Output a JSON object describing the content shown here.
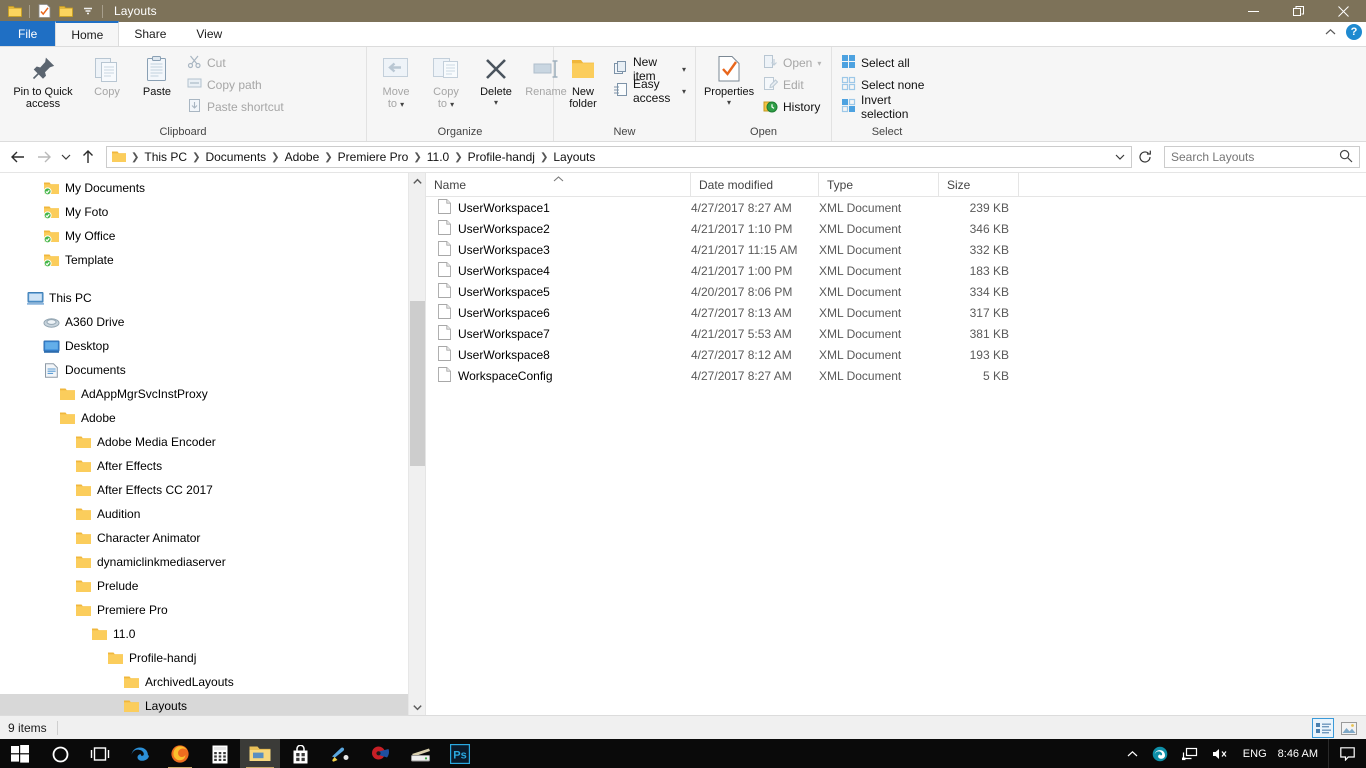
{
  "window": {
    "title": "Layouts",
    "quick_access": [
      "folder-icon",
      "properties-check-icon",
      "new-folder-icon",
      "customize-qat-caret"
    ],
    "controls": {
      "minimize": "minimize-icon",
      "restore": "restore-icon",
      "close": "close-icon"
    }
  },
  "tabs": [
    {
      "label": "File",
      "kind": "file"
    },
    {
      "label": "Home",
      "kind": "active"
    },
    {
      "label": "Share",
      "kind": "normal"
    },
    {
      "label": "View",
      "kind": "normal"
    }
  ],
  "tab_right": {
    "collapse": "chevron-up-icon",
    "help": "?"
  },
  "ribbon": {
    "groups": [
      {
        "label": "Clipboard",
        "big": [
          {
            "label": "Pin to Quick\naccess",
            "line1": "Pin to Quick",
            "line2": "access",
            "icon": "pin-icon",
            "disabled": false
          },
          {
            "label": "Copy",
            "line1": "Copy",
            "line2": "",
            "icon": "copy-icon",
            "disabled": true
          },
          {
            "label": "Paste",
            "line1": "Paste",
            "line2": "",
            "icon": "paste-icon",
            "disabled": false
          }
        ],
        "small": [
          {
            "label": "Cut",
            "icon": "scissors-icon",
            "disabled": true
          },
          {
            "label": "Copy path",
            "icon": "copy-path-icon",
            "disabled": true
          },
          {
            "label": "Paste shortcut",
            "icon": "paste-shortcut-icon",
            "disabled": true
          }
        ]
      },
      {
        "label": "Organize",
        "big": [
          {
            "label": "Move to",
            "line1": "Move",
            "line2": "to",
            "icon": "move-to-icon",
            "disabled": true,
            "caret": true
          },
          {
            "label": "Copy to",
            "line1": "Copy",
            "line2": "to",
            "icon": "copy-to-icon",
            "disabled": true,
            "caret": true
          },
          {
            "label": "Delete",
            "line1": "Delete",
            "line2": "",
            "icon": "delete-x-icon",
            "disabled": false,
            "caret": true
          },
          {
            "label": "Rename",
            "line1": "Rename",
            "line2": "",
            "icon": "rename-icon",
            "disabled": true
          }
        ],
        "small": []
      },
      {
        "label": "New",
        "big": [
          {
            "label": "New folder",
            "line1": "New",
            "line2": "folder",
            "icon": "new-folder-icon",
            "disabled": false
          }
        ],
        "small": [
          {
            "label": "New item",
            "icon": "new-item-icon",
            "disabled": false,
            "caret": true
          },
          {
            "label": "Easy access",
            "icon": "easy-access-icon",
            "disabled": false,
            "caret": true
          }
        ]
      },
      {
        "label": "Open",
        "big": [
          {
            "label": "Properties",
            "line1": "Properties",
            "line2": "",
            "icon": "properties-icon",
            "disabled": false,
            "caret": true
          }
        ],
        "small": [
          {
            "label": "Open",
            "icon": "open-icon",
            "disabled": true,
            "caret": true
          },
          {
            "label": "Edit",
            "icon": "edit-icon",
            "disabled": true
          },
          {
            "label": "History",
            "icon": "history-icon",
            "disabled": false
          }
        ]
      },
      {
        "label": "Select",
        "big": [],
        "small": [
          {
            "label": "Select all",
            "icon": "select-all-icon",
            "disabled": false
          },
          {
            "label": "Select none",
            "icon": "select-none-icon",
            "disabled": false
          },
          {
            "label": "Invert selection",
            "icon": "invert-selection-icon",
            "disabled": false
          }
        ]
      }
    ]
  },
  "address": {
    "back": "back-arrow-icon",
    "forward": "forward-arrow-icon",
    "recent": "recent-locations-caret",
    "up": "up-arrow-icon",
    "crumbs": [
      "This PC",
      "Documents",
      "Adobe",
      "Premiere Pro",
      "11.0",
      "Profile-handj",
      "Layouts"
    ],
    "refresh": "refresh-icon",
    "dropdown": "address-dropdown-caret"
  },
  "search": {
    "placeholder": "Search Layouts",
    "value": "",
    "icon": "search-icon"
  },
  "sidebar": {
    "items": [
      {
        "label": "My Documents",
        "icon": "folder-synced-icon",
        "indent": 2,
        "selected": false
      },
      {
        "label": "My Foto",
        "icon": "folder-synced-icon",
        "indent": 2,
        "selected": false
      },
      {
        "label": "My Office",
        "icon": "folder-synced-icon",
        "indent": 2,
        "selected": false
      },
      {
        "label": "Template",
        "icon": "folder-synced-icon",
        "indent": 2,
        "selected": false
      },
      {
        "label": "",
        "icon": "spacer",
        "indent": 0,
        "selected": false
      },
      {
        "label": "This PC",
        "icon": "this-pc-icon",
        "indent": 1,
        "selected": false
      },
      {
        "label": "A360 Drive",
        "icon": "a360-drive-icon",
        "indent": 2,
        "selected": false
      },
      {
        "label": "Desktop",
        "icon": "desktop-icon",
        "indent": 2,
        "selected": false
      },
      {
        "label": "Documents",
        "icon": "documents-icon",
        "indent": 2,
        "selected": false
      },
      {
        "label": "AdAppMgrSvcInstProxy",
        "icon": "folder-icon",
        "indent": 3,
        "selected": false
      },
      {
        "label": "Adobe",
        "icon": "folder-icon",
        "indent": 3,
        "selected": false
      },
      {
        "label": "Adobe Media Encoder",
        "icon": "folder-icon",
        "indent": 4,
        "selected": false
      },
      {
        "label": "After Effects",
        "icon": "folder-icon",
        "indent": 4,
        "selected": false
      },
      {
        "label": "After Effects CC 2017",
        "icon": "folder-icon",
        "indent": 4,
        "selected": false
      },
      {
        "label": "Audition",
        "icon": "folder-icon",
        "indent": 4,
        "selected": false
      },
      {
        "label": "Character Animator",
        "icon": "folder-icon",
        "indent": 4,
        "selected": false
      },
      {
        "label": "dynamiclinkmediaserver",
        "icon": "folder-icon",
        "indent": 4,
        "selected": false
      },
      {
        "label": "Prelude",
        "icon": "folder-icon",
        "indent": 4,
        "selected": false
      },
      {
        "label": "Premiere Pro",
        "icon": "folder-icon",
        "indent": 4,
        "selected": false
      },
      {
        "label": "11.0",
        "icon": "folder-icon",
        "indent": 5,
        "selected": false
      },
      {
        "label": "Profile-handj",
        "icon": "folder-icon",
        "indent": 6,
        "selected": false
      },
      {
        "label": "ArchivedLayouts",
        "icon": "folder-icon",
        "indent": 7,
        "selected": false
      },
      {
        "label": "Layouts",
        "icon": "folder-icon",
        "indent": 7,
        "selected": true
      }
    ],
    "scrollbar": {
      "up": "scroll-up-arrow",
      "down": "scroll-down-arrow"
    }
  },
  "filelist": {
    "columns": [
      {
        "label": "Name",
        "sorted": true,
        "sort_dir": "asc"
      },
      {
        "label": "Date modified",
        "sorted": false
      },
      {
        "label": "Type",
        "sorted": false
      },
      {
        "label": "Size",
        "sorted": false
      }
    ],
    "rows": [
      {
        "name": "UserWorkspace1",
        "date": "4/27/2017 8:27 AM",
        "type": "XML Document",
        "size": "239 KB",
        "icon": "xml-file-icon"
      },
      {
        "name": "UserWorkspace2",
        "date": "4/21/2017 1:10 PM",
        "type": "XML Document",
        "size": "346 KB",
        "icon": "xml-file-icon"
      },
      {
        "name": "UserWorkspace3",
        "date": "4/21/2017 11:15 AM",
        "type": "XML Document",
        "size": "332 KB",
        "icon": "xml-file-icon"
      },
      {
        "name": "UserWorkspace4",
        "date": "4/21/2017 1:00 PM",
        "type": "XML Document",
        "size": "183 KB",
        "icon": "xml-file-icon"
      },
      {
        "name": "UserWorkspace5",
        "date": "4/20/2017 8:06 PM",
        "type": "XML Document",
        "size": "334 KB",
        "icon": "xml-file-icon"
      },
      {
        "name": "UserWorkspace6",
        "date": "4/27/2017 8:13 AM",
        "type": "XML Document",
        "size": "317 KB",
        "icon": "xml-file-icon"
      },
      {
        "name": "UserWorkspace7",
        "date": "4/21/2017 5:53 AM",
        "type": "XML Document",
        "size": "381 KB",
        "icon": "xml-file-icon"
      },
      {
        "name": "UserWorkspace8",
        "date": "4/27/2017 8:12 AM",
        "type": "XML Document",
        "size": "193 KB",
        "icon": "xml-file-icon"
      },
      {
        "name": "WorkspaceConfig",
        "date": "4/27/2017 8:27 AM",
        "type": "XML Document",
        "size": "5 KB",
        "icon": "xml-file-icon"
      }
    ]
  },
  "status": {
    "item_count": "9 items",
    "views": [
      {
        "name": "details-view",
        "active": true
      },
      {
        "name": "large-icons-view",
        "active": false
      }
    ]
  },
  "taskbar": {
    "items": [
      {
        "name": "start-button",
        "icon": "windows-logo"
      },
      {
        "name": "cortana-search",
        "icon": "circle-icon"
      },
      {
        "name": "task-view",
        "icon": "task-view-icon"
      },
      {
        "name": "edge",
        "icon": "edge-icon"
      },
      {
        "name": "firefox",
        "icon": "firefox-icon"
      },
      {
        "name": "calculator",
        "icon": "calculator-icon"
      },
      {
        "name": "file-explorer",
        "icon": "folder-icon"
      },
      {
        "name": "store",
        "icon": "store-icon"
      },
      {
        "name": "paint",
        "icon": "paint-icon"
      },
      {
        "name": "media-app",
        "icon": "media-icon"
      },
      {
        "name": "scanner",
        "icon": "scanner-icon"
      },
      {
        "name": "photoshop",
        "icon": "ps-icon"
      }
    ],
    "tray": {
      "chevron": "show-hidden-icons",
      "icons": [
        "edge-tray-icon",
        "network-icon",
        "volume-muted-icon"
      ],
      "language": "ENG",
      "time": "8:46 AM",
      "action_center": "action-center-icon"
    }
  },
  "colors": {
    "titlebar": "#7d7259",
    "file_tab": "#1f6fc4",
    "accent": "#0078d7",
    "selection": "#cce1f5",
    "taskbar": "#0a0a0a"
  }
}
